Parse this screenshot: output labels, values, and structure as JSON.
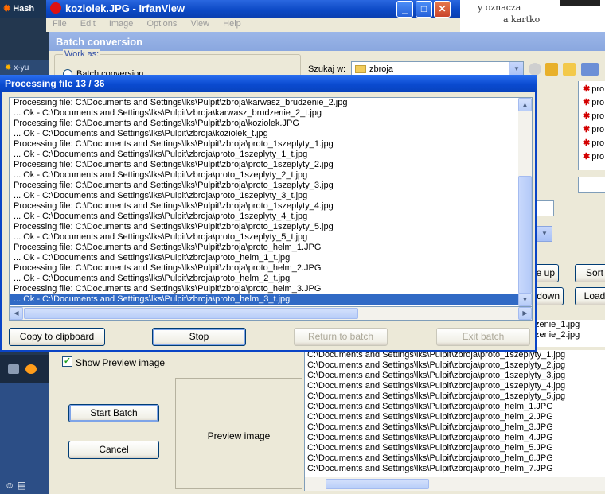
{
  "desktop": {
    "top_label": "Hash",
    "strip_label": "x-yu"
  },
  "irfanview": {
    "title": "koziolek.JPG - IrfanView",
    "menu": [
      "File",
      "Edit",
      "Image",
      "Options",
      "View",
      "Help"
    ]
  },
  "background_doc": {
    "line1": "y oznacza",
    "line2": "a kartko"
  },
  "batch": {
    "title": "Batch conversion",
    "work_as_label": "Work as:",
    "work_as_option": "Batch conversion",
    "look_in_label": "Szukaj w:",
    "look_in_value": "zbroja",
    "file_list_top": [
      "pro",
      "pro",
      "pro",
      "pro",
      "pro",
      "pro"
    ],
    "buttons": {
      "move_up": "Move up",
      "sort": "Sort",
      "move_down": "Move down",
      "load": "Load",
      "start_batch": "Start Batch",
      "cancel": "Cancel"
    },
    "show_preview_label": "Show Preview image",
    "preview_label": "Preview image",
    "input_files_partial": [
      "zenie_1.jpg",
      "zenie_2.jpg"
    ],
    "input_files": [
      "C:\\Documents and Settings\\lks\\Pulpit\\zbroja\\proto_1szeplyty_1.jpg",
      "C:\\Documents and Settings\\lks\\Pulpit\\zbroja\\proto_1szeplyty_2.jpg",
      "C:\\Documents and Settings\\lks\\Pulpit\\zbroja\\proto_1szeplyty_3.jpg",
      "C:\\Documents and Settings\\lks\\Pulpit\\zbroja\\proto_1szeplyty_4.jpg",
      "C:\\Documents and Settings\\lks\\Pulpit\\zbroja\\proto_1szeplyty_5.jpg",
      "C:\\Documents and Settings\\lks\\Pulpit\\zbroja\\proto_helm_1.JPG",
      "C:\\Documents and Settings\\lks\\Pulpit\\zbroja\\proto_helm_2.JPG",
      "C:\\Documents and Settings\\lks\\Pulpit\\zbroja\\proto_helm_3.JPG",
      "C:\\Documents and Settings\\lks\\Pulpit\\zbroja\\proto_helm_4.JPG",
      "C:\\Documents and Settings\\lks\\Pulpit\\zbroja\\proto_helm_5.JPG",
      "C:\\Documents and Settings\\lks\\Pulpit\\zbroja\\proto_helm_6.JPG",
      "C:\\Documents and Settings\\lks\\Pulpit\\zbroja\\proto_helm_7.JPG"
    ]
  },
  "processing": {
    "title": "Processing file 13 / 36",
    "lines": [
      "Processing file: C:\\Documents and Settings\\lks\\Pulpit\\zbroja\\karwasz_brudzenie_2.jpg",
      "... Ok - C:\\Documents and Settings\\lks\\Pulpit\\zbroja\\karwasz_brudzenie_2_t.jpg",
      "Processing file: C:\\Documents and Settings\\lks\\Pulpit\\zbroja\\koziolek.JPG",
      "... Ok - C:\\Documents and Settings\\lks\\Pulpit\\zbroja\\koziolek_t.jpg",
      "Processing file: C:\\Documents and Settings\\lks\\Pulpit\\zbroja\\proto_1szeplyty_1.jpg",
      "... Ok - C:\\Documents and Settings\\lks\\Pulpit\\zbroja\\proto_1szeplyty_1_t.jpg",
      "Processing file: C:\\Documents and Settings\\lks\\Pulpit\\zbroja\\proto_1szeplyty_2.jpg",
      "... Ok - C:\\Documents and Settings\\lks\\Pulpit\\zbroja\\proto_1szeplyty_2_t.jpg",
      "Processing file: C:\\Documents and Settings\\lks\\Pulpit\\zbroja\\proto_1szeplyty_3.jpg",
      "... Ok - C:\\Documents and Settings\\lks\\Pulpit\\zbroja\\proto_1szeplyty_3_t.jpg",
      "Processing file: C:\\Documents and Settings\\lks\\Pulpit\\zbroja\\proto_1szeplyty_4.jpg",
      "... Ok - C:\\Documents and Settings\\lks\\Pulpit\\zbroja\\proto_1szeplyty_4_t.jpg",
      "Processing file: C:\\Documents and Settings\\lks\\Pulpit\\zbroja\\proto_1szeplyty_5.jpg",
      "... Ok - C:\\Documents and Settings\\lks\\Pulpit\\zbroja\\proto_1szeplyty_5_t.jpg",
      "Processing file: C:\\Documents and Settings\\lks\\Pulpit\\zbroja\\proto_helm_1.JPG",
      "... Ok - C:\\Documents and Settings\\lks\\Pulpit\\zbroja\\proto_helm_1_t.jpg",
      "Processing file: C:\\Documents and Settings\\lks\\Pulpit\\zbroja\\proto_helm_2.JPG",
      "... Ok - C:\\Documents and Settings\\lks\\Pulpit\\zbroja\\proto_helm_2_t.jpg",
      "Processing file: C:\\Documents and Settings\\lks\\Pulpit\\zbroja\\proto_helm_3.JPG",
      "... Ok - C:\\Documents and Settings\\lks\\Pulpit\\zbroja\\proto_helm_3_t.jpg"
    ],
    "buttons": {
      "copy": "Copy to clipboard",
      "stop": "Stop",
      "return": "Return to batch",
      "exit": "Exit batch"
    }
  }
}
